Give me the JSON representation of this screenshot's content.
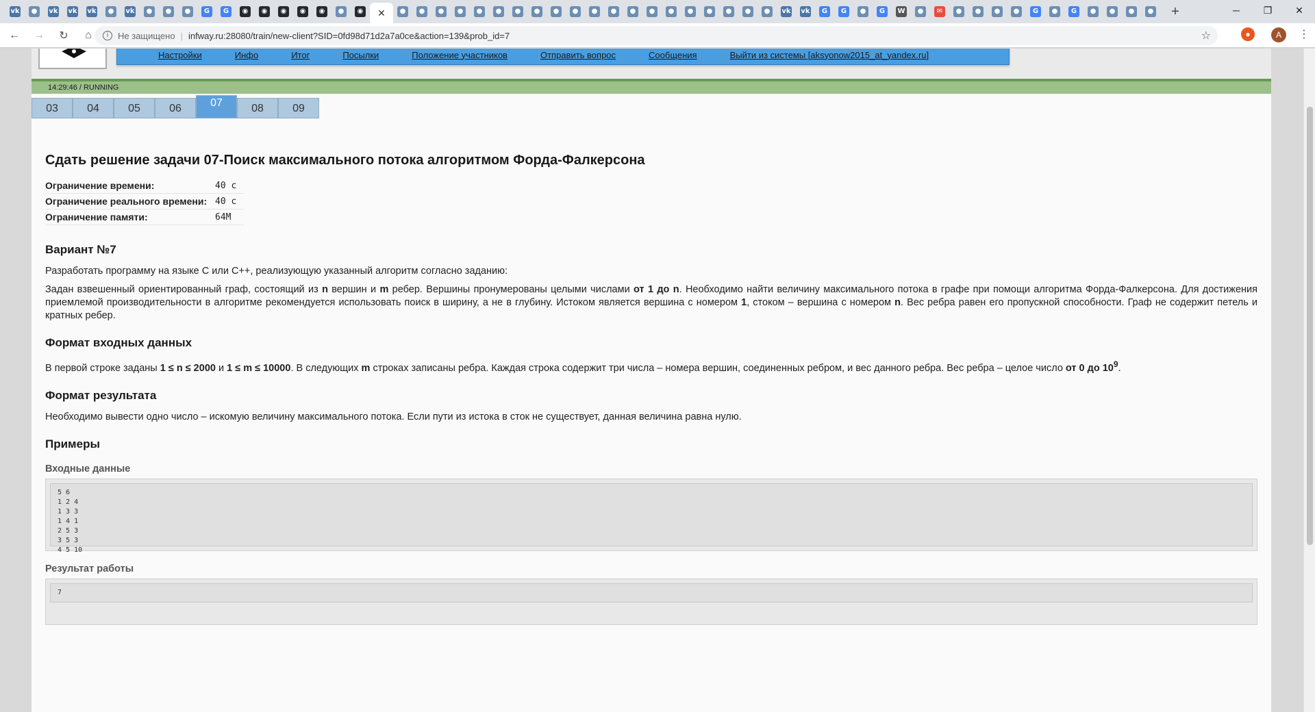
{
  "browser": {
    "tab_icons": [
      "vk-icon",
      "site-icon",
      "vk-icon",
      "vk-icon",
      "vk-icon",
      "site-icon",
      "vk-icon",
      "site-icon",
      "site-icon",
      "site-icon",
      "google-icon",
      "google-icon",
      "github-icon",
      "github-icon",
      "github-icon",
      "github-icon",
      "github-icon",
      "site-icon",
      "github-icon"
    ],
    "after_tab_icons": [
      "site-icon",
      "site-icon",
      "site-icon",
      "site-icon",
      "site-icon",
      "site-icon",
      "site-icon",
      "site-icon",
      "site-icon",
      "site-icon",
      "site-icon",
      "site-icon",
      "site-icon",
      "site-icon",
      "site-icon",
      "site-icon",
      "site-icon",
      "site-icon",
      "site-icon",
      "site-icon",
      "vk-icon",
      "vk-icon",
      "google-icon",
      "google-icon",
      "site-icon",
      "google-icon",
      "wiki-icon",
      "site-icon",
      "mail-icon",
      "site-icon",
      "site-icon",
      "site-icon",
      "site-icon",
      "google-icon",
      "site-icon",
      "google-icon",
      "site-icon",
      "site-icon",
      "site-icon",
      "site-icon"
    ],
    "security_label": "Не защищено",
    "url": "infway.ru:28080/train/new-client?SID=0fd98d71d2a7a0ce&action=139&prob_id=7",
    "avatar_letter": "A"
  },
  "nav": {
    "items": [
      "Настройки",
      "Инфо",
      "Итог",
      "Посылки",
      "Положение участников",
      "Отправить вопрос",
      "Сообщения",
      "Выйти из системы [aksyonow2015_at_yandex.ru]"
    ]
  },
  "status": {
    "text": "14:29:46 / RUNNING"
  },
  "problem_tabs": [
    "03",
    "04",
    "05",
    "06",
    "07",
    "08",
    "09"
  ],
  "problem": {
    "title": "Сдать решение задачи 07-Поиск максимального потока алгоритмом Форда-Фалкерсона",
    "limits": [
      {
        "key": "Ограничение времени:",
        "value": "40 с"
      },
      {
        "key": "Ограничение реального времени:",
        "value": "40 с"
      },
      {
        "key": "Ограничение памяти:",
        "value": "64M"
      }
    ],
    "variant_title": "Вариант №7",
    "intro": "Разработать программу на языке C или C++, реализующую указанный алгоритм согласно заданию:",
    "statement": {
      "t1": "Задан взвешенный ориентированный граф, состоящий из ",
      "n1": "n",
      "t2": " вершин и ",
      "m1": "m",
      "t3": " ребер. Вершины пронумерованы целыми числами ",
      "range": "от 1 до n",
      "t4": ". Необходимо найти величину максимального потока в графе при помощи алгоритма Форда-Фалкерсона. Для достижения приемлемой производительности в алгоритме рекомендуется использовать поиск в ширину, а не в глубину. Истоком является вершина с номером ",
      "one": "1",
      "t5": ", стоком – вершина с номером ",
      "n2": "n",
      "t6": ". Вес ребра равен его пропускной способности. Граф не содержит петель и кратных ребер."
    },
    "input_title": "Формат входных данных",
    "input": {
      "t1": "В первой строке заданы ",
      "c1": "1 ≤ n ≤ 2000",
      "t2": " и ",
      "c2": "1 ≤ m ≤ 10000",
      "t3": ". В следующих ",
      "m": "m",
      "t4": " строках записаны ребра. Каждая строка содержит три числа – номера вершин, соединенных ребром, и вес данного ребра. Вес ребра – целое число ",
      "w": "от 0 до 10",
      "exp": "9",
      "t5": "."
    },
    "output_title": "Формат результата",
    "output": "Необходимо вывести одно число – искомую величину максимального потока. Если пути из истока в сток не существует, данная величина равна нулю.",
    "examples_title": "Примеры",
    "example_input_label": "Входные данные",
    "example_input": "5 6\n1 2 4\n1 3 3\n1 4 1\n2 5 3\n3 5 3\n4 5 10",
    "example_output_label": "Результат работы",
    "example_output": "7"
  }
}
